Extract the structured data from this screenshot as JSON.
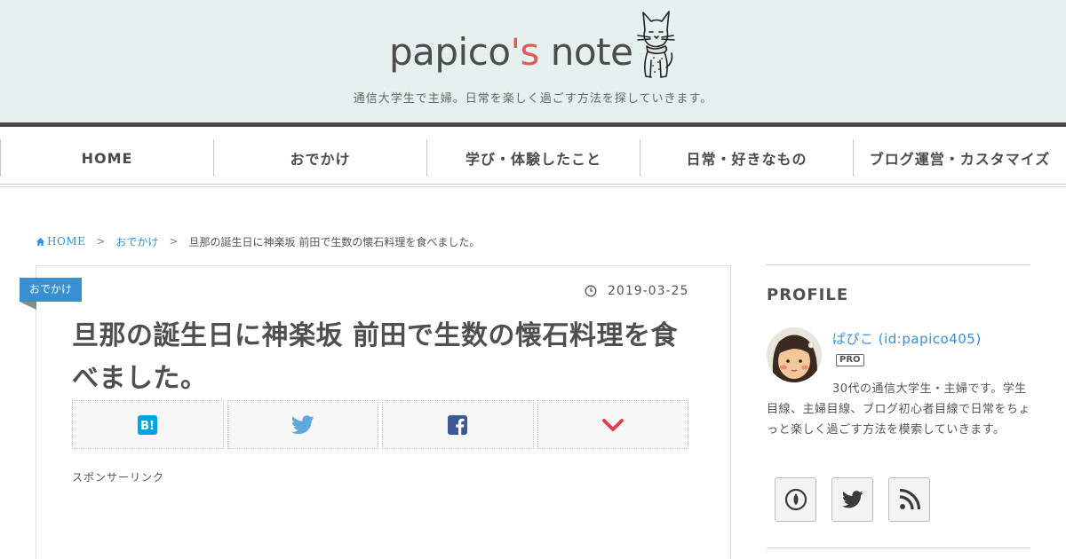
{
  "header": {
    "logo_main": "papico",
    "logo_accent": "'s",
    "logo_tail": " note",
    "tagline": "通信大学生で主婦。日常を楽しく過ごす方法を探していきます。",
    "accent_color": "#e15a55",
    "background_color": "#e6f0ef"
  },
  "nav": {
    "items": [
      {
        "label": "HOME"
      },
      {
        "label": "おでかけ"
      },
      {
        "label": "学び・体験したこと"
      },
      {
        "label": "日常・好きなもの"
      },
      {
        "label": "ブログ運営・カスタマイズ"
      }
    ]
  },
  "breadcrumb": {
    "home": "HOME",
    "category": "おでかけ",
    "current": "旦那の誕生日に神楽坂 前田で生数の懐石料理を食べました。",
    "separator": ">"
  },
  "article": {
    "category_badge": "おでかけ",
    "date": "2019-03-25",
    "title": "旦那の誕生日に神楽坂 前田で生数の懐石料理を食べました。",
    "share_buttons": [
      {
        "icon": "hatena-bookmark-icon"
      },
      {
        "icon": "twitter-icon"
      },
      {
        "icon": "facebook-icon"
      },
      {
        "icon": "pocket-icon"
      }
    ],
    "sponsor_label": "スポンサーリンク",
    "link_color": "#3a8fd0"
  },
  "sidebar": {
    "heading": "PROFILE",
    "profile_name": "ぱぴこ (id:papico405)",
    "pro_badge": "PRO",
    "description": "30代の通信大学生・主婦です。学生目線、主婦目線、ブログ初心者目線で日常をちょっと楽しく過ごす方法を模索していきます。",
    "social_buttons": [
      {
        "icon": "hatena-blog-icon"
      },
      {
        "icon": "twitter-icon"
      },
      {
        "icon": "rss-icon"
      }
    ]
  }
}
